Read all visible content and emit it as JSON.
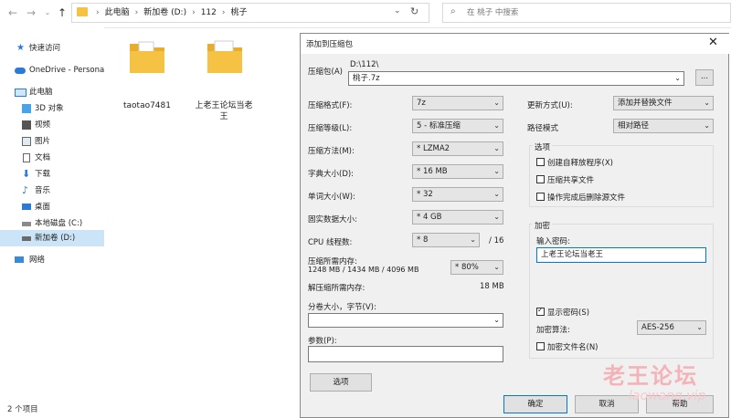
{
  "explorer": {
    "path": [
      "此电脑",
      "新加卷 (D:)",
      "112",
      "桃子"
    ],
    "search_placeholder": "在 桃子 中搜索",
    "sidebar": [
      {
        "label": "快速访问",
        "icon": "star-icon"
      },
      {
        "label": "OneDrive - Persona",
        "icon": "cloud-icon"
      },
      {
        "label": "此电脑",
        "icon": "computer-icon"
      },
      {
        "label": "3D 对象",
        "icon": "cube-icon"
      },
      {
        "label": "视频",
        "icon": "video-icon"
      },
      {
        "label": "图片",
        "icon": "picture-icon"
      },
      {
        "label": "文档",
        "icon": "document-icon"
      },
      {
        "label": "下载",
        "icon": "download-icon"
      },
      {
        "label": "音乐",
        "icon": "music-icon"
      },
      {
        "label": "桌面",
        "icon": "desktop-icon"
      },
      {
        "label": "本地磁盘 (C:)",
        "icon": "drive-icon"
      },
      {
        "label": "新加卷 (D:)",
        "icon": "drive-icon"
      },
      {
        "label": "网络",
        "icon": "network-icon"
      }
    ],
    "files": [
      {
        "name": "taotao7481"
      },
      {
        "name": "上老王论坛当老王"
      }
    ],
    "status": "2 个项目"
  },
  "dialog": {
    "title": "添加到压缩包",
    "archive_label": "压缩包(A)",
    "archive_dir": "D:\\112\\",
    "archive_name": "桃子.7z",
    "browse_label": "...",
    "format_label": "压缩格式(F):",
    "format_value": "7z",
    "level_label": "压缩等级(L):",
    "level_value": "5 - 标准压缩",
    "method_label": "压缩方法(M):",
    "method_value": "* LZMA2",
    "dict_label": "字典大小(D):",
    "dict_value": "* 16 MB",
    "word_label": "单词大小(W):",
    "word_value": "* 32",
    "solid_label": "固实数据大小:",
    "solid_value": "* 4 GB",
    "cpu_label": "CPU 线程数:",
    "cpu_value": "* 8",
    "cpu_total": "/ 16",
    "mem_label": "压缩所需内存:",
    "mem_value": "1248 MB / 1434 MB / 4096 MB",
    "mem_pct": "* 80%",
    "demem_label": "解压缩所需内存:",
    "demem_value": "18 MB",
    "split_label": "分卷大小，字节(V):",
    "param_label": "参数(P):",
    "options_button": "选项",
    "update_label": "更新方式(U):",
    "update_value": "添加并替换文件",
    "pathmode_label": "路径模式",
    "pathmode_value": "相对路径",
    "options_group": "选项",
    "opt_sfx": "创建自释放程序(X)",
    "opt_shared": "压缩共享文件",
    "opt_delete": "操作完成后删除源文件",
    "encrypt_group": "加密",
    "pwd_label": "输入密码:",
    "pwd_value": "上老王论坛当老王",
    "show_pwd": "显示密码(S)",
    "enc_method_label": "加密算法:",
    "enc_method_value": "AES-256",
    "enc_names": "加密文件名(N)",
    "ok": "确定",
    "cancel": "取消",
    "help": "帮助"
  },
  "watermark": {
    "text": "老王论坛",
    "sub": "laowang.vip"
  },
  "colors": {
    "folder": "#f5c243",
    "selection": "#cce4f7",
    "accent": "#0078d7"
  }
}
